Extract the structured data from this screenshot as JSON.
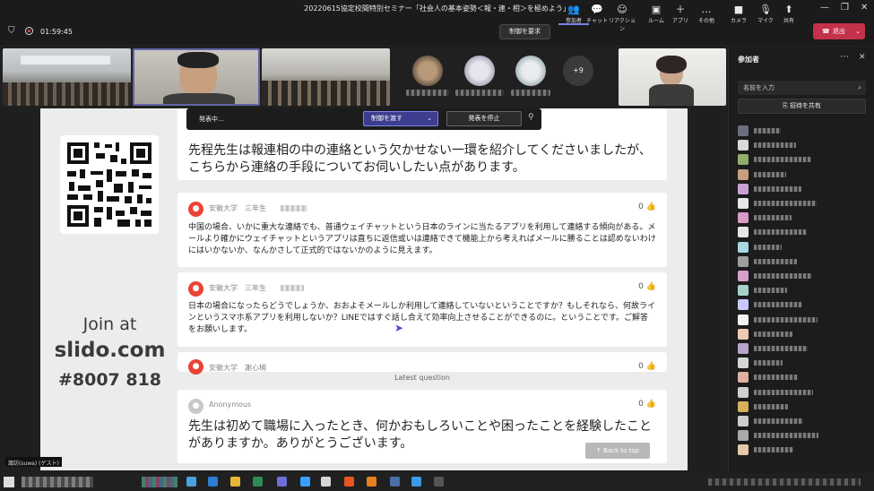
{
  "window": {
    "title": "20220615協定校間特別セミナー「社会人の基本姿勢＜報・連・相＞を極めよう」"
  },
  "meeting": {
    "timer": "01:59:45",
    "request_control_label": "制御を要求",
    "toolbar": [
      {
        "label": "参加者",
        "icon": "people-icon",
        "glyph": "👥"
      },
      {
        "label": "チャット",
        "icon": "chat-icon",
        "glyph": "💬"
      },
      {
        "label": "リアクション",
        "icon": "reaction-icon",
        "glyph": "☺"
      },
      {
        "label": "ルーム",
        "icon": "room-icon",
        "glyph": "▣"
      },
      {
        "label": "アプリ",
        "icon": "apps-icon",
        "glyph": "＋"
      },
      {
        "label": "その他",
        "icon": "more-icon",
        "glyph": "…"
      },
      {
        "label": "カメラ",
        "icon": "camera-icon",
        "glyph": "■"
      },
      {
        "label": "マイク",
        "icon": "mic-off-icon",
        "glyph": "🎙"
      },
      {
        "label": "共有",
        "icon": "share-icon",
        "glyph": "⬆"
      }
    ],
    "leave_label": "退出",
    "overflow_count": "+9"
  },
  "presenter_bar": {
    "status": "発表中...",
    "give_control": "制御を渡す",
    "stop_presenting": "発表を停止"
  },
  "slido": {
    "join_at": "Join at",
    "site": "slido.com",
    "code": "#8007 818",
    "top_question": "先程先生は報連相の中の連絡という欠かせない一環を紹介してくださいましたが、こちらから連絡の手段についてお伺いしたい点があります。",
    "questions": [
      {
        "author": "安徽大学　三年生",
        "likes": "0",
        "text": "中国の場合、いかに重大な連絡でも、普通ウェイチャットという日本のラインに当たるアプリを利用して連絡する傾向がある。メールより確かにウェイチャットというアプリは直ちに返信或いは連絡できて機能上から考えればメールに勝ることは認めないわけにはいかないか、なんかさして正式的ではないかのように見えます。"
      },
      {
        "author": "安徽大学　三年生",
        "likes": "0",
        "text": "日本の場合になったらどうでしょうか、おおよそメールしか利用して連絡していないということですか？もしそれなら、何故ラインというスマホ系アプリを利用しないか？LINEではすぐ話し合えて効率向上させることができるのに。ということです。ご解答をお願いします。"
      },
      {
        "author": "安徽大学　謝心楠",
        "likes": "0",
        "text": ""
      }
    ],
    "latest_label": "Latest question",
    "latest": {
      "author": "Anonymous",
      "likes": "0",
      "text": "先生は初めて職場に入ったとき、何かおもしろいことや困ったことを経験したことがありますか。ありがとうございます。"
    },
    "back_to_top": "Back to top"
  },
  "participants_panel": {
    "title": "参加者",
    "search_placeholder": "名前を入力",
    "share_invite": "招待を共有"
  },
  "guest_tag": "諏訪(suwa) (ゲスト)"
}
